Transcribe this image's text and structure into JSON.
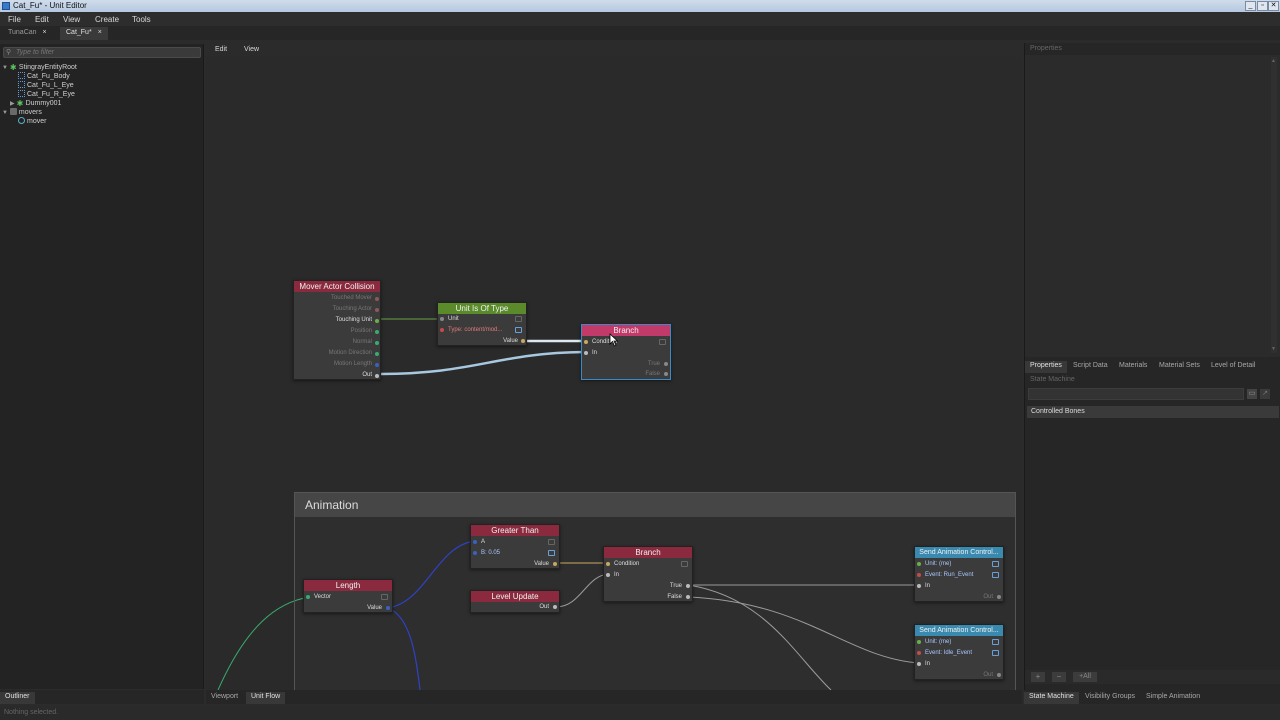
{
  "window": {
    "title": "Cat_Fu* - Unit Editor",
    "controls": [
      "_",
      "▫",
      "✕"
    ]
  },
  "menu": [
    "File",
    "Edit",
    "View",
    "Create",
    "Tools"
  ],
  "doc_tabs": [
    {
      "label": "TunaCan",
      "close": "×"
    },
    {
      "label": "Cat_Fu*",
      "close": "×"
    }
  ],
  "outliner": {
    "search_placeholder": "Type to filter",
    "items": [
      {
        "label": "StingrayEntityRoot",
        "icon": "entity-icon"
      },
      {
        "label": "Cat_Fu_Body",
        "icon": "mesh-icon"
      },
      {
        "label": "Cat_Fu_L_Eye",
        "icon": "mesh-icon"
      },
      {
        "label": "Cat_Fu_R_Eye",
        "icon": "mesh-icon"
      },
      {
        "label": "Dummy001",
        "icon": "entity-icon"
      },
      {
        "label": "movers",
        "icon": "folder-icon"
      },
      {
        "label": "mover",
        "icon": "mover-icon"
      }
    ],
    "bottom_tab": "Outliner"
  },
  "center": {
    "toolbar": [
      "Edit",
      "View"
    ],
    "bottom_tabs": [
      "Viewport",
      "Unit Flow"
    ]
  },
  "nodes": {
    "mover_actor_collision": {
      "title": "Mover Actor Collision",
      "ports": [
        "Touched Mover",
        "Touching Actor",
        "Touching Unit",
        "Position",
        "Normal",
        "Motion Direction",
        "Motion Length",
        "Out"
      ]
    },
    "unit_is_of_type": {
      "title": "Unit Is Of Type",
      "in_unit": "Unit",
      "in_type": "Type: content/mod...",
      "out_value": "Value"
    },
    "branch_top": {
      "title": "Branch",
      "in_condition": "Condition",
      "in_in": "In",
      "out_true": "True",
      "out_false": "False"
    },
    "animation_group": {
      "title": "Animation"
    },
    "length": {
      "title": "Length",
      "in_vector": "Vector",
      "out_value": "Value"
    },
    "greater_than": {
      "title": "Greater Than",
      "in_a": "A",
      "in_b": "B: 0.05",
      "out_value": "Value"
    },
    "level_update": {
      "title": "Level Update",
      "out": "Out"
    },
    "branch_anim": {
      "title": "Branch",
      "in_condition": "Condition",
      "in_in": "In",
      "out_true": "True",
      "out_false": "False"
    },
    "send_anim_run": {
      "title": "Send Animation Control...",
      "unit": "Unit: (me)",
      "event": "Event: Run_Event",
      "in": "In",
      "out": "Out"
    },
    "send_anim_idle": {
      "title": "Send Animation Control...",
      "unit": "Unit: (me)",
      "event": "Event: Idle_Event",
      "in": "In",
      "out": "Out"
    }
  },
  "right": {
    "properties_header": "Properties",
    "tabs": [
      "Properties",
      "Script Data",
      "Materials",
      "Material Sets",
      "Level of Detail"
    ],
    "state_machine_label": "State Machine",
    "controlled_bones": "Controlled Bones",
    "footer_buttons": [
      "+",
      "−",
      "+All"
    ],
    "bottom_tabs": [
      "State Machine",
      "Visibility Groups",
      "Simple Animation"
    ]
  },
  "status": "Nothing selected.",
  "colors": {
    "node_red": "#8b2a3e",
    "node_green": "#5a8a2a",
    "node_pink": "#c23a6a",
    "node_blue": "#3a8ab0",
    "wire_blue": "#2a3fc4",
    "wire_green": "#3aaa70",
    "wire_light": "#a8c8e0"
  }
}
